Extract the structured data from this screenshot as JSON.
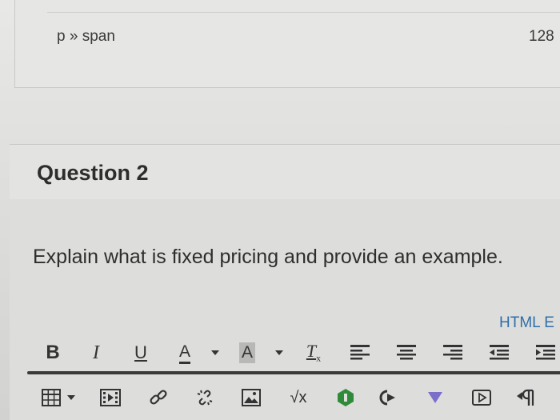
{
  "previous_editor": {
    "element_path": "p » span",
    "word_count": "128"
  },
  "question": {
    "title": "Question 2",
    "prompt": "Explain what is fixed pricing and provide an example.",
    "html_editor_link": "HTML E"
  },
  "toolbar": {
    "bold_label": "B",
    "italic_label": "I",
    "underline_label": "U",
    "font_color_label": "A",
    "background_color_label": "A",
    "clear_format_label": "T",
    "clear_format_sub": "x",
    "math_label": "√x",
    "icons": {
      "table": "table-icon",
      "media": "media-icon",
      "link": "link-icon",
      "unlink": "unlink-icon",
      "image": "image-icon",
      "apps": "apps-icon",
      "embed": "embed-icon",
      "dropdown": "dropdown-icon",
      "video": "video-icon",
      "direction": "paragraph-direction-icon"
    },
    "colors": {
      "apps_green": "#2e8b3a",
      "dropdown_purple": "#7b6fc9",
      "link_blue": "#2f6fa8"
    }
  }
}
